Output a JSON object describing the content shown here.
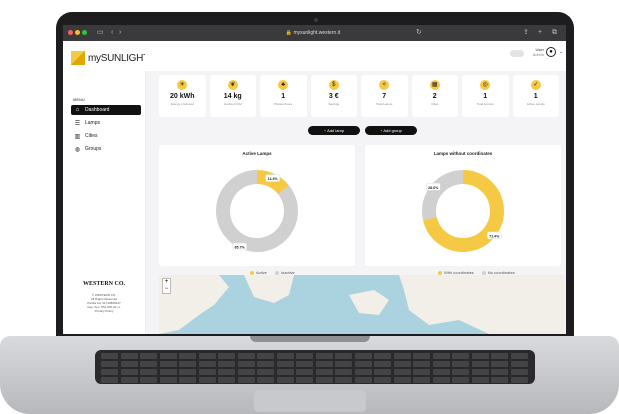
{
  "browser": {
    "url": "mysunlight.western.it"
  },
  "app": {
    "name": "mySUNLIGHT"
  },
  "sidebar": {
    "menu_title": "MENU",
    "items": [
      {
        "label": "Dashboard",
        "icon": "home-icon",
        "active": true
      },
      {
        "label": "Lamps",
        "icon": "list-icon",
        "active": false
      },
      {
        "label": "Cities",
        "icon": "building-icon",
        "active": false
      },
      {
        "label": "Groups",
        "icon": "globe-icon",
        "active": false
      }
    ],
    "brand": "WESTERN CO.",
    "footer_lines": [
      "© WESTERN CO.",
      "All Rights Reserved",
      "Partita iva: 01743860447",
      "Cap. Soc. €51.000,00 i.v.",
      "Privacy Policy"
    ]
  },
  "header": {
    "user_name": "User",
    "user_role": "Admin"
  },
  "stats": [
    {
      "value": "20 kWh",
      "label": "Energy produced",
      "icon": "sun-icon"
    },
    {
      "value": "14 kg",
      "label": "Avoided CO2",
      "icon": "leaf-icon"
    },
    {
      "value": "1",
      "label": "Planted trees",
      "icon": "tree-icon"
    },
    {
      "value": "3 €",
      "label": "Savings",
      "icon": "money-icon"
    },
    {
      "value": "7",
      "label": "Total Lamps",
      "icon": "bulb-icon"
    },
    {
      "value": "2",
      "label": "Cities",
      "icon": "city-icon"
    },
    {
      "value": "1",
      "label": "Total Groups",
      "icon": "group-icon"
    },
    {
      "value": "1",
      "label": "Active Lamps",
      "icon": "check-icon"
    }
  ],
  "actions": {
    "add_lamp": "Add lamp",
    "add_group": "Add group"
  },
  "colors": {
    "accent": "#f6c945",
    "grey": "#d0d0d0",
    "dark": "#111111"
  },
  "chart_data": [
    {
      "type": "pie",
      "title": "Active Lamps",
      "categories": [
        "Active",
        "Inactive"
      ],
      "values": [
        14.3,
        85.7
      ],
      "labels": [
        "14.3%",
        "85.7%"
      ]
    },
    {
      "type": "pie",
      "title": "Lamps without coordinates",
      "categories": [
        "With coordinates",
        "No coordinates"
      ],
      "values": [
        71.4,
        28.6
      ],
      "labels": [
        "71.4%",
        "28.6%"
      ]
    }
  ],
  "map": {
    "zoom_in": "+",
    "zoom_out": "−"
  }
}
